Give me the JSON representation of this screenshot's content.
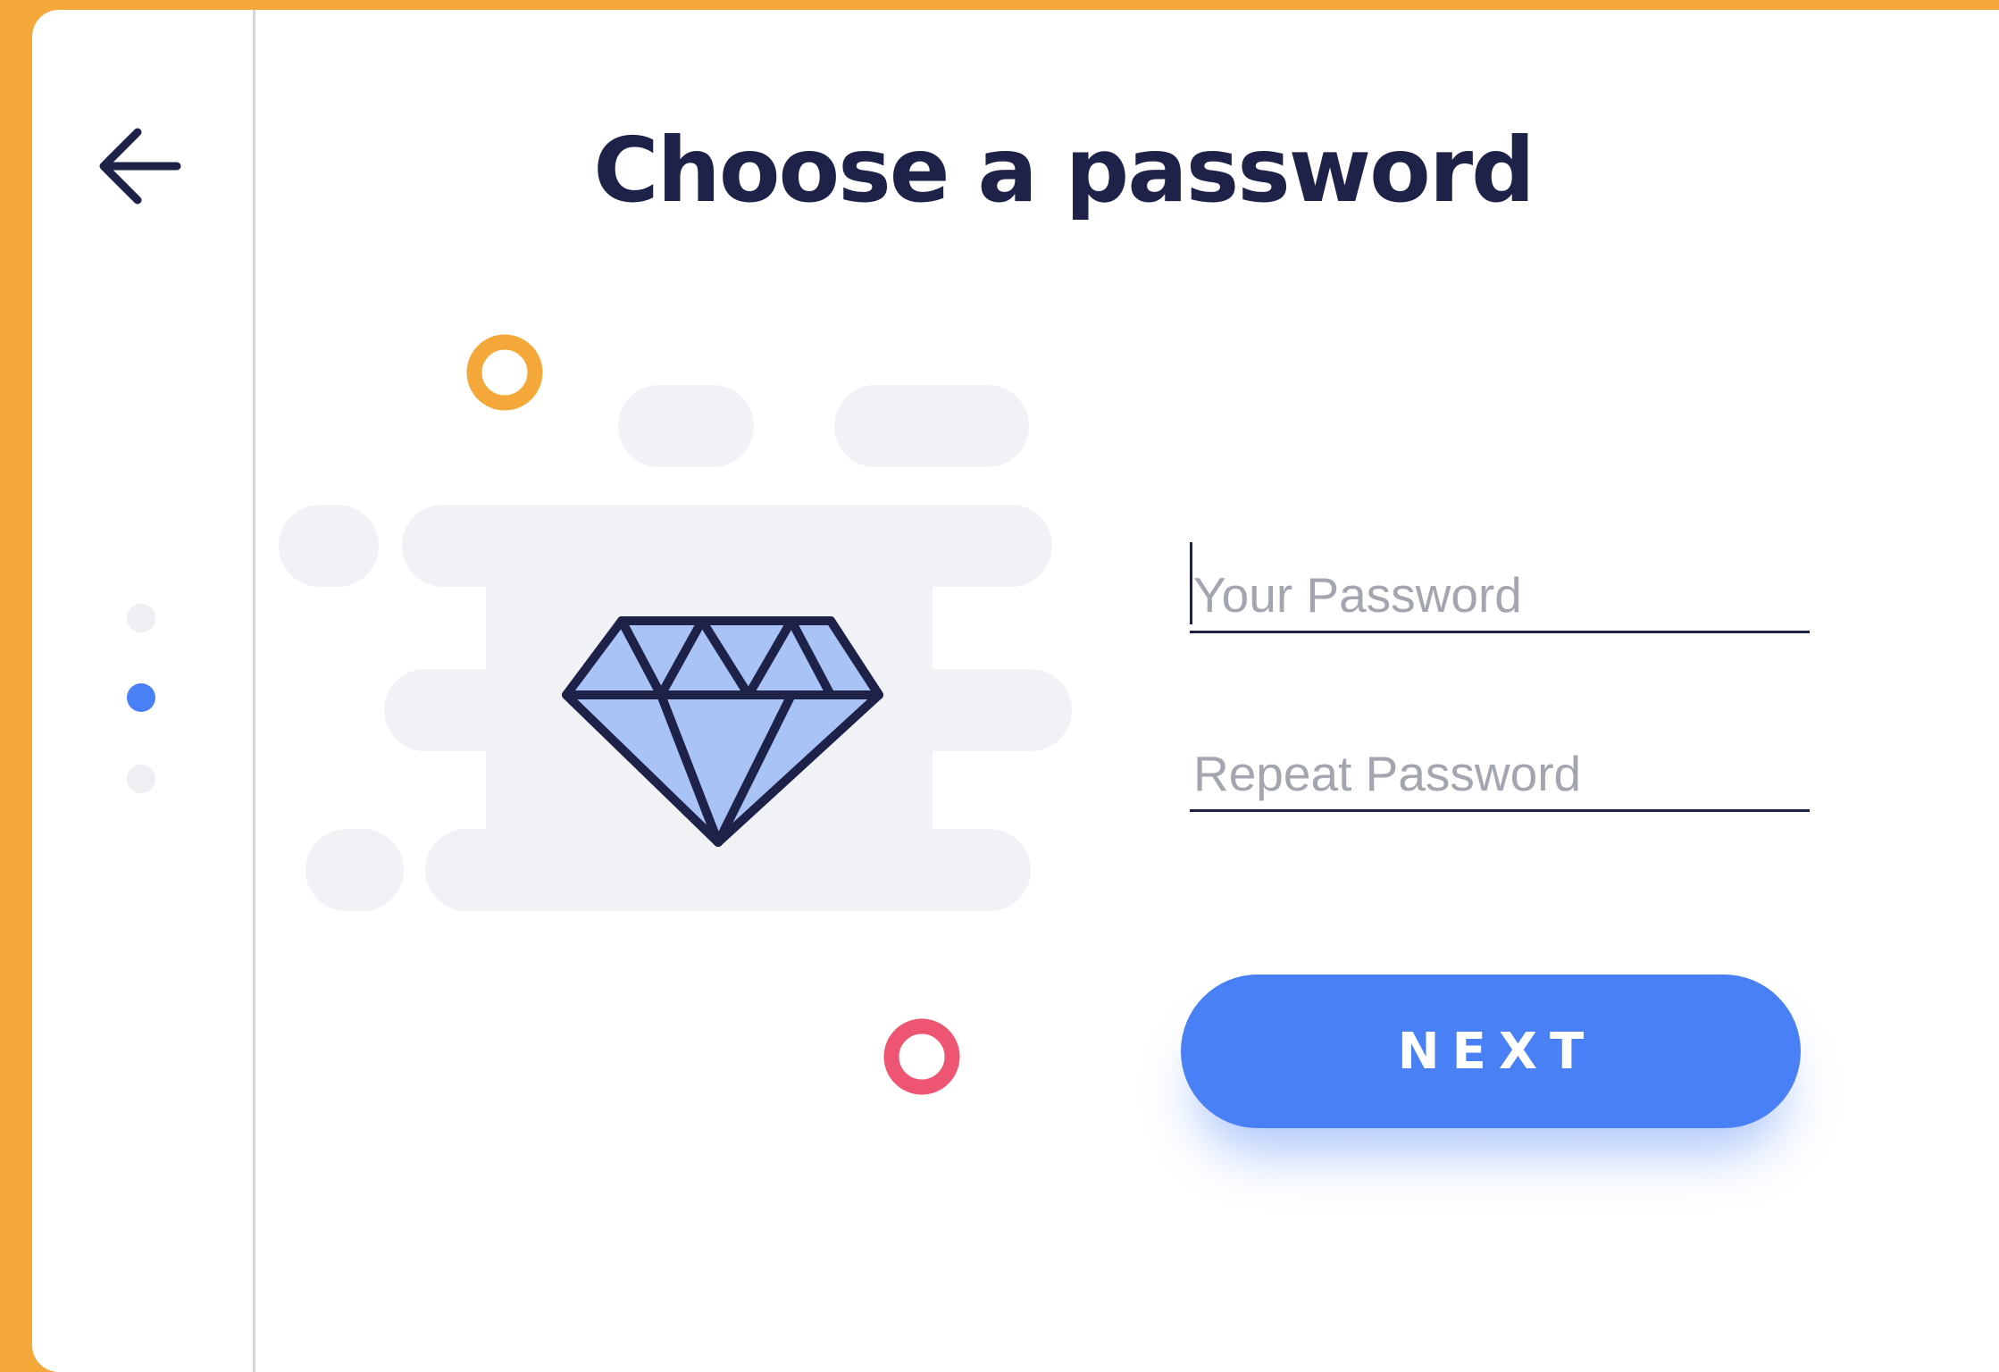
{
  "page": {
    "title": "Choose a password"
  },
  "navigation": {
    "back_icon": "arrow-left-icon",
    "steps_total": 3,
    "current_step": 2
  },
  "form": {
    "password_placeholder": "Your Password",
    "password_value": "",
    "repeat_placeholder": "Repeat Password",
    "repeat_value": "",
    "next_label": "NEXT"
  },
  "illustration": {
    "icon": "diamond-icon",
    "decorations": [
      "orange-ring-icon",
      "pink-ring-icon"
    ]
  },
  "colors": {
    "frame": "#F4A83A",
    "primary": "#4A80F5",
    "text_dark": "#1E2248",
    "diamond_fill": "#A9C3F7",
    "ring_orange": "#F4A83A",
    "ring_pink": "#EE5573",
    "cloud": "#F1F2F5"
  }
}
